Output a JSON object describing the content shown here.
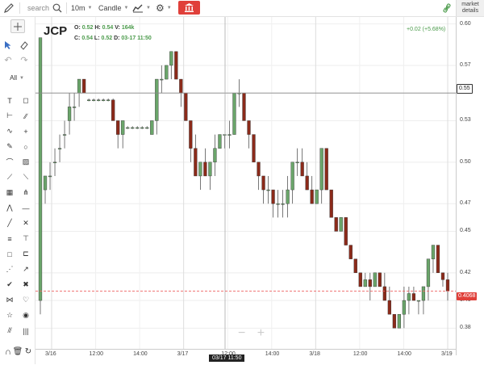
{
  "topbar": {
    "search_placeholder": "search",
    "interval": "10m",
    "chart_type": "Candle"
  },
  "market_details": [
    "market",
    "details"
  ],
  "symbol": "JCP",
  "ohlc": {
    "o_label": "O:",
    "o": "0.52",
    "h_label": "H:",
    "h": "0.54",
    "v_label": "V:",
    "v": "164k",
    "c_label": "C:",
    "c": "0.54",
    "l_label": "L:",
    "l": "0.52",
    "d_label": "D:",
    "d": "03-17 11:50"
  },
  "change": "+0.02 (+5.68%)",
  "toolbar": {
    "filter": "All"
  },
  "price_tags": {
    "cursor": "0.55",
    "last": "0.4068"
  },
  "cursor_time": "03/17 11:50",
  "zoom": {
    "minus": "−",
    "plus": "+"
  },
  "colors": {
    "up": "#6aa56a",
    "down": "#8b2a1a",
    "accent": "#e0403a"
  },
  "chart_data": {
    "type": "candlestick",
    "y_ticks": [
      "0.60",
      "0.57",
      "0.55",
      "0.53",
      "0.50",
      "0.47",
      "0.45",
      "0.42",
      "0.40",
      "0.38"
    ],
    "x_ticks": [
      "3/16",
      "12:00",
      "14:00",
      "3/17",
      "12:00",
      "14:00",
      "3/18",
      "12:00",
      "14:00",
      "3/19"
    ],
    "ylim": [
      0.365,
      0.605
    ],
    "grid": true,
    "candles": [
      [
        0.4,
        0.59,
        0.39,
        0.59
      ],
      [
        0.48,
        0.49,
        0.47,
        0.49
      ],
      [
        0.49,
        0.5,
        0.48,
        0.49
      ],
      [
        0.5,
        0.51,
        0.49,
        0.5
      ],
      [
        0.51,
        0.52,
        0.5,
        0.51
      ],
      [
        0.52,
        0.53,
        0.51,
        0.52
      ],
      [
        0.53,
        0.55,
        0.52,
        0.54
      ],
      [
        0.54,
        0.55,
        0.53,
        0.54
      ],
      [
        0.55,
        0.56,
        0.54,
        0.56
      ],
      [
        0.56,
        0.56,
        0.55,
        0.55
      ],
      [
        0.545,
        0.546,
        0.544,
        0.545
      ],
      [
        0.545,
        0.546,
        0.544,
        0.545
      ],
      [
        0.545,
        0.546,
        0.544,
        0.545
      ],
      [
        0.545,
        0.546,
        0.544,
        0.545
      ],
      [
        0.545,
        0.546,
        0.544,
        0.545
      ],
      [
        0.545,
        0.546,
        0.544,
        0.53
      ],
      [
        0.53,
        0.53,
        0.51,
        0.52
      ],
      [
        0.52,
        0.53,
        0.51,
        0.53
      ],
      [
        0.525,
        0.526,
        0.524,
        0.525
      ],
      [
        0.525,
        0.526,
        0.524,
        0.525
      ],
      [
        0.525,
        0.526,
        0.524,
        0.525
      ],
      [
        0.525,
        0.526,
        0.524,
        0.525
      ],
      [
        0.525,
        0.526,
        0.524,
        0.525
      ],
      [
        0.52,
        0.53,
        0.52,
        0.53
      ],
      [
        0.53,
        0.56,
        0.52,
        0.56
      ],
      [
        0.56,
        0.57,
        0.55,
        0.56
      ],
      [
        0.56,
        0.57,
        0.56,
        0.57
      ],
      [
        0.57,
        0.58,
        0.56,
        0.58
      ],
      [
        0.58,
        0.58,
        0.56,
        0.56
      ],
      [
        0.56,
        0.56,
        0.54,
        0.55
      ],
      [
        0.55,
        0.55,
        0.53,
        0.53
      ],
      [
        0.53,
        0.53,
        0.5,
        0.51
      ],
      [
        0.51,
        0.52,
        0.49,
        0.49
      ],
      [
        0.49,
        0.5,
        0.48,
        0.5
      ],
      [
        0.5,
        0.51,
        0.49,
        0.49
      ],
      [
        0.49,
        0.5,
        0.48,
        0.5
      ],
      [
        0.5,
        0.52,
        0.49,
        0.51
      ],
      [
        0.51,
        0.52,
        0.51,
        0.52
      ],
      [
        0.52,
        0.52,
        0.51,
        0.52
      ],
      [
        0.52,
        0.53,
        0.51,
        0.52
      ],
      [
        0.52,
        0.55,
        0.52,
        0.55
      ],
      [
        0.55,
        0.56,
        0.54,
        0.55
      ],
      [
        0.55,
        0.55,
        0.53,
        0.53
      ],
      [
        0.53,
        0.53,
        0.51,
        0.52
      ],
      [
        0.52,
        0.52,
        0.5,
        0.5
      ],
      [
        0.5,
        0.5,
        0.48,
        0.49
      ],
      [
        0.49,
        0.49,
        0.47,
        0.48
      ],
      [
        0.48,
        0.49,
        0.47,
        0.48
      ],
      [
        0.48,
        0.48,
        0.46,
        0.47
      ],
      [
        0.47,
        0.48,
        0.46,
        0.47
      ],
      [
        0.47,
        0.48,
        0.46,
        0.47
      ],
      [
        0.47,
        0.49,
        0.46,
        0.48
      ],
      [
        0.48,
        0.5,
        0.47,
        0.5
      ],
      [
        0.5,
        0.51,
        0.49,
        0.5
      ],
      [
        0.5,
        0.51,
        0.49,
        0.49
      ],
      [
        0.49,
        0.5,
        0.48,
        0.48
      ],
      [
        0.48,
        0.49,
        0.47,
        0.47
      ],
      [
        0.47,
        0.48,
        0.47,
        0.48
      ],
      [
        0.48,
        0.51,
        0.47,
        0.51
      ],
      [
        0.51,
        0.51,
        0.48,
        0.48
      ],
      [
        0.48,
        0.48,
        0.46,
        0.46
      ],
      [
        0.46,
        0.46,
        0.45,
        0.45
      ],
      [
        0.45,
        0.46,
        0.45,
        0.46
      ],
      [
        0.46,
        0.46,
        0.44,
        0.44
      ],
      [
        0.44,
        0.44,
        0.43,
        0.43
      ],
      [
        0.43,
        0.43,
        0.42,
        0.42
      ],
      [
        0.42,
        0.42,
        0.41,
        0.41
      ],
      [
        0.41,
        0.42,
        0.41,
        0.415
      ],
      [
        0.415,
        0.42,
        0.4,
        0.41
      ],
      [
        0.41,
        0.42,
        0.41,
        0.42
      ],
      [
        0.42,
        0.42,
        0.41,
        0.41
      ],
      [
        0.41,
        0.42,
        0.4,
        0.4
      ],
      [
        0.4,
        0.41,
        0.39,
        0.39
      ],
      [
        0.39,
        0.39,
        0.38,
        0.38
      ],
      [
        0.38,
        0.39,
        0.38,
        0.39
      ],
      [
        0.39,
        0.41,
        0.38,
        0.4
      ],
      [
        0.4,
        0.41,
        0.39,
        0.405
      ],
      [
        0.405,
        0.41,
        0.4,
        0.4
      ],
      [
        0.4,
        0.4,
        0.39,
        0.4
      ],
      [
        0.4,
        0.41,
        0.39,
        0.41
      ],
      [
        0.41,
        0.43,
        0.4,
        0.43
      ],
      [
        0.43,
        0.44,
        0.42,
        0.44
      ],
      [
        0.44,
        0.44,
        0.42,
        0.42
      ],
      [
        0.42,
        0.42,
        0.41,
        0.415
      ],
      [
        0.415,
        0.42,
        0.4,
        0.4068
      ]
    ]
  }
}
